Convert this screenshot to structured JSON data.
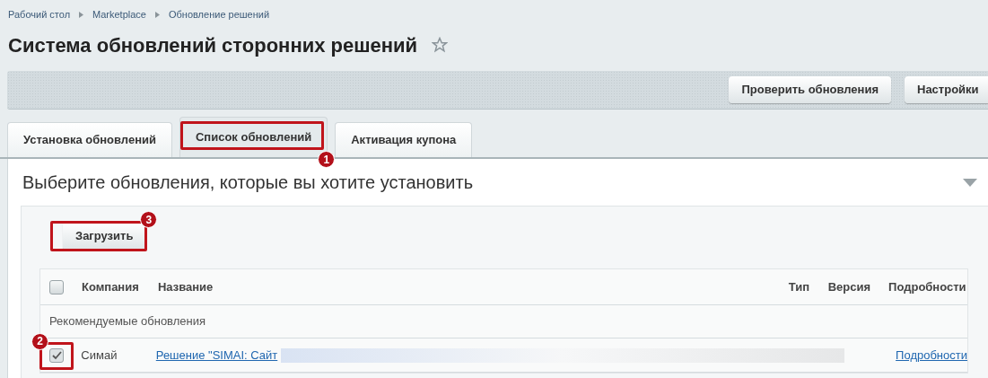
{
  "breadcrumbs": [
    "Рабочий стол",
    "Marketplace",
    "Обновление решений"
  ],
  "title": "Система обновлений сторонних решений",
  "favorite": false,
  "toolbar_buttons": [
    "Проверить обновления",
    "Настройки"
  ],
  "tabs": [
    {
      "label": "Установка обновлений",
      "selected": false
    },
    {
      "label": "Список обновлений",
      "selected": true,
      "annotation": "1"
    },
    {
      "label": "Активация купона",
      "selected": false
    }
  ],
  "panel": {
    "heading": "Выберите обновления, которые вы хотите установить",
    "expanded": true
  },
  "load_button": {
    "label": "Загрузить",
    "annotation": "3"
  },
  "table": {
    "select_all": false,
    "columns": [
      "Компания",
      "Название",
      "Тип",
      "Версия",
      "Подробности"
    ],
    "groups": [
      {
        "title": "Рекомендуемые обновления",
        "rows": [
          {
            "checked": true,
            "annotation": "2",
            "company": "Симай",
            "name": "Решение \"SIMAI: Сайт",
            "details": "Подробности"
          }
        ]
      }
    ]
  }
}
